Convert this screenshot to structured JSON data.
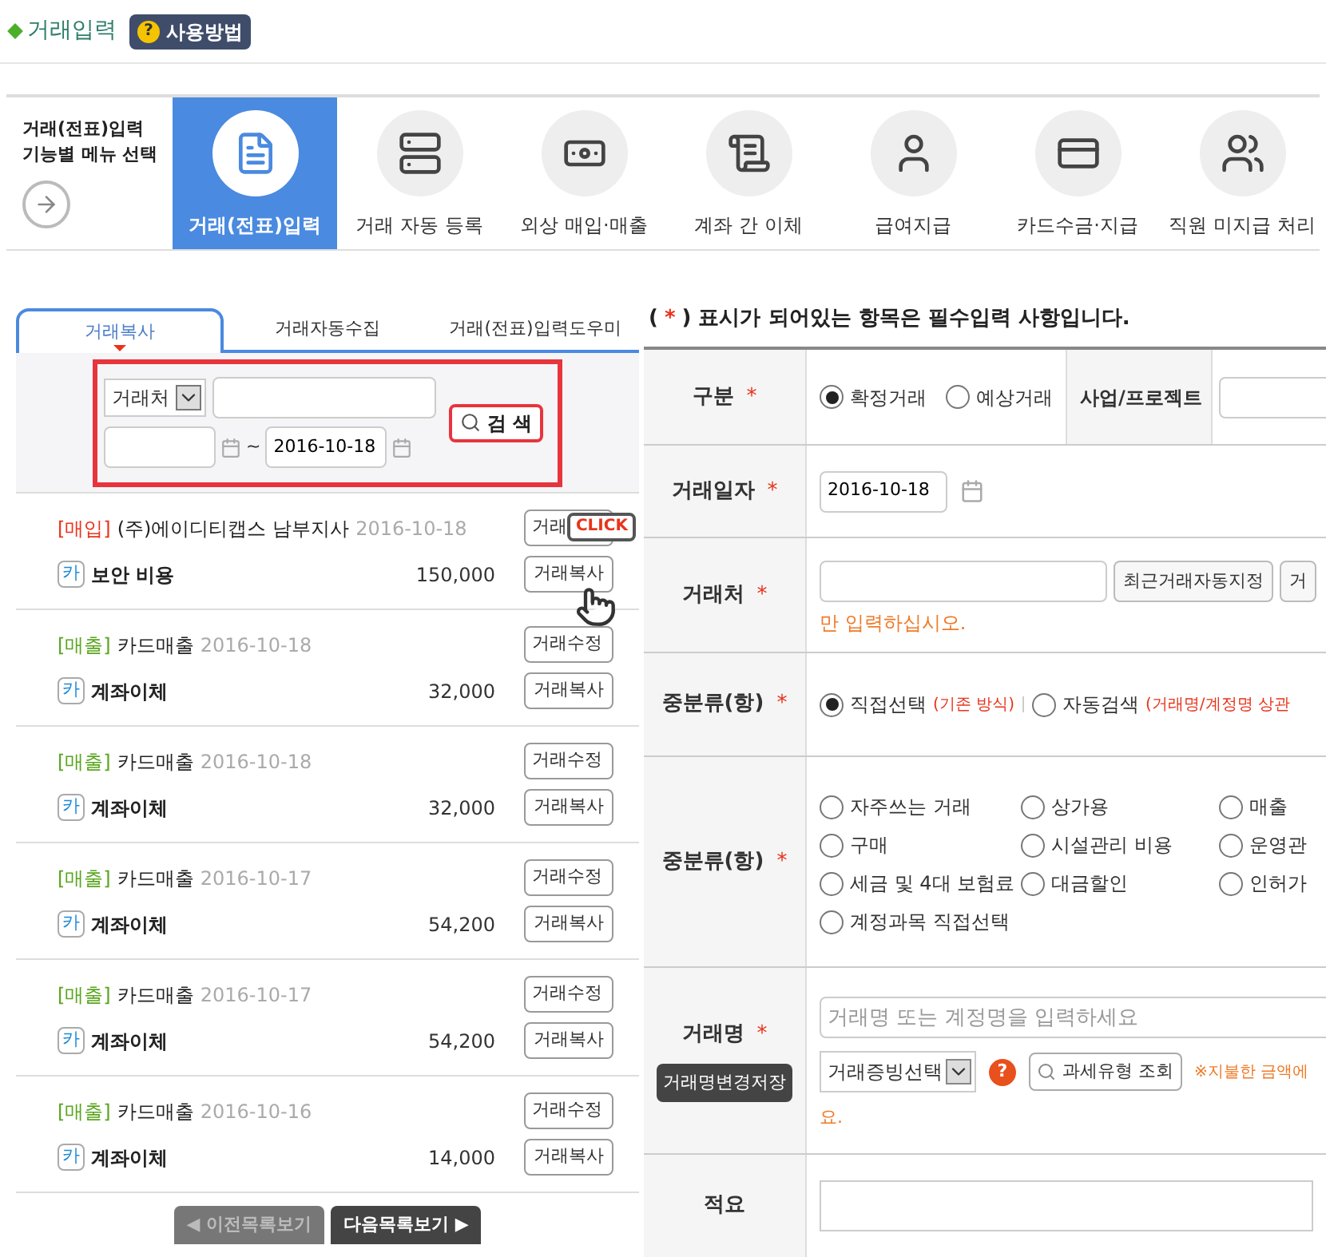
{
  "header": {
    "title": "거래입력",
    "help_icon": "?",
    "help_button": "사용방법"
  },
  "menu": {
    "caption": "거래(전표)입력 기능별 메뉴 선택",
    "items": [
      {
        "label": "거래(전표)입력",
        "selected": true
      },
      {
        "label": "거래 자동 등록",
        "selected": false
      },
      {
        "label": "외상 매입·매출",
        "selected": false
      },
      {
        "label": "계좌 간 이체",
        "selected": false
      },
      {
        "label": "급여지급",
        "selected": false
      },
      {
        "label": "카드수금·지급",
        "selected": false
      },
      {
        "label": "직원 미지급 처리",
        "selected": false
      }
    ]
  },
  "left_tabs": [
    {
      "label": "거래복사",
      "selected": true
    },
    {
      "label": "거래자동수집",
      "selected": false
    },
    {
      "label": "거래(전표)입력도우미",
      "selected": false
    }
  ],
  "search": {
    "filter": "거래처",
    "tilde": "~",
    "date_to": "2016-10-18",
    "button": "검 색"
  },
  "transactions": [
    {
      "kind": "purchase",
      "tag": "[매입]",
      "party": "(주)에이디티캡스 남부지사",
      "date": "2016-10-18",
      "badge": "카",
      "item": "보안 비용",
      "amount": "150,000",
      "edit_button": "거래",
      "copy_button": "거래복사"
    },
    {
      "kind": "sale",
      "tag": "[매출]",
      "party": "카드매출",
      "date": "2016-10-18",
      "badge": "카",
      "item": "계좌이체",
      "amount": "32,000",
      "edit_button": "거래수정",
      "copy_button": "거래복사"
    },
    {
      "kind": "sale",
      "tag": "[매출]",
      "party": "카드매출",
      "date": "2016-10-18",
      "badge": "카",
      "item": "계좌이체",
      "amount": "32,000",
      "edit_button": "거래수정",
      "copy_button": "거래복사"
    },
    {
      "kind": "sale",
      "tag": "[매출]",
      "party": "카드매출",
      "date": "2016-10-17",
      "badge": "카",
      "item": "계좌이체",
      "amount": "54,200",
      "edit_button": "거래수정",
      "copy_button": "거래복사"
    },
    {
      "kind": "sale",
      "tag": "[매출]",
      "party": "카드매출",
      "date": "2016-10-17",
      "badge": "카",
      "item": "계좌이체",
      "amount": "54,200",
      "edit_button": "거래수정",
      "copy_button": "거래복사"
    },
    {
      "kind": "sale",
      "tag": "[매출]",
      "party": "카드매출",
      "date": "2016-10-16",
      "badge": "카",
      "item": "계좌이체",
      "amount": "14,000",
      "edit_button": "거래수정",
      "copy_button": "거래복사"
    }
  ],
  "callout": "CLICK",
  "pager": [
    {
      "label": "◀ 이전목록보기",
      "disabled": true
    },
    {
      "label": "다음목록보기 ▶",
      "disabled": false
    }
  ],
  "form": {
    "notice_open": "(",
    "required_mark": "*",
    "notice": ") 표시가 되어있는 항목은 필수입력 사항입니다.",
    "rows": [
      {
        "kind": "type",
        "label": "구분",
        "required": true,
        "options": [
          {
            "label": "확정거래",
            "selected": true
          },
          {
            "label": "예상거래",
            "selected": false
          }
        ],
        "side_label": "사업/프로젝트"
      },
      {
        "kind": "date",
        "label": "거래일자",
        "required": true,
        "value": "2016-10-18"
      },
      {
        "kind": "party",
        "label": "거래처",
        "required": true,
        "buttons": [
          "최근거래자동지정",
          "거"
        ],
        "hint": "만 입력하십시오."
      },
      {
        "kind": "mode",
        "label": "중분류(항)",
        "required": true,
        "options": [
          {
            "label": "직접선택",
            "note": "(기존 방식)",
            "selected": true
          },
          {
            "label": "자동검색",
            "note": "(거래명/계정명 상관",
            "selected": false
          }
        ]
      },
      {
        "kind": "categories",
        "label": "중분류(항)",
        "required": true,
        "options": [
          {
            "label": "자주쓰는 거래",
            "selected": false
          },
          {
            "label": "상가용",
            "selected": false
          },
          {
            "label": "매출",
            "selected": false
          },
          {
            "label": "구매",
            "selected": false
          },
          {
            "label": "시설관리 비용",
            "selected": false
          },
          {
            "label": "운영관",
            "selected": false
          },
          {
            "label": "세금 및 4대 보험료",
            "selected": false
          },
          {
            "label": "대금할인",
            "selected": false
          },
          {
            "label": "인허가",
            "selected": false
          },
          {
            "label": "계정과목 직접선택",
            "selected": false
          }
        ]
      },
      {
        "kind": "name",
        "label": "거래명",
        "required": true,
        "save_button": "거래명변경저장",
        "placeholder": "거래명 또는 계정명을 입력하세요",
        "proof_select": "거래증빙선택",
        "help_icon": "?",
        "tax_button": "과세유형 조회",
        "note": "※지불한 금액에",
        "note_tail": "요."
      },
      {
        "kind": "memo",
        "label": "적요",
        "required": false
      }
    ]
  }
}
